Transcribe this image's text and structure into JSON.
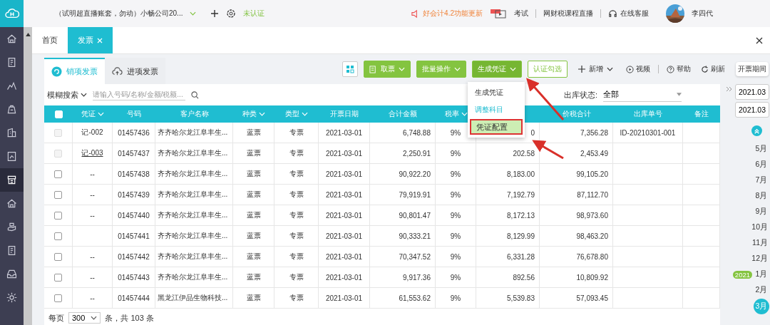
{
  "sidebar": {
    "items": [
      {
        "kind": "home",
        "selected": false
      },
      {
        "kind": "document",
        "selected": false
      },
      {
        "kind": "chart",
        "selected": false
      },
      {
        "kind": "bag",
        "selected": false
      },
      {
        "kind": "building",
        "selected": false
      },
      {
        "kind": "report",
        "selected": false
      },
      {
        "kind": "invoice",
        "selected": true
      },
      {
        "kind": "home",
        "selected": false
      },
      {
        "kind": "hand",
        "selected": false
      },
      {
        "kind": "document",
        "selected": false
      },
      {
        "kind": "tray",
        "selected": false
      },
      {
        "kind": "gear",
        "selected": false
      }
    ]
  },
  "header": {
    "account": "（试明超直播账套，勿动）小畅公司20...",
    "status": "未认证",
    "notice": "好会计4.2功能更新",
    "exam": "考试",
    "live": "网财税课程直播",
    "service": "在线客服",
    "user": "李四代"
  },
  "tabs": [
    {
      "label": "首页",
      "selected": false
    },
    {
      "label": "发票",
      "selected": true
    }
  ],
  "subtabs": [
    {
      "label": "销项发票",
      "selected": true
    },
    {
      "label": "进项发票",
      "selected": false
    }
  ],
  "toolbar": {
    "buttons": [
      {
        "label": "取票",
        "kind": "solid",
        "expanded": false
      },
      {
        "label": "批量操作",
        "kind": "solid",
        "expanded": false
      },
      {
        "label": "生成凭证",
        "kind": "solid",
        "expanded": true
      },
      {
        "label": "认证勾选",
        "kind": "outline",
        "expanded": false
      },
      {
        "label": "新增",
        "kind": "add",
        "expanded": false
      }
    ],
    "links": [
      {
        "label": "视频",
        "kind": "video"
      },
      {
        "label": "帮助",
        "kind": "help"
      },
      {
        "label": "刷新",
        "kind": "refresh"
      }
    ],
    "period_tooltip": "开票期间"
  },
  "menu": [
    {
      "label": "生成凭证",
      "kind": "plain",
      "selected": false
    },
    {
      "label": "调整科目",
      "kind": "accent",
      "selected": false
    },
    {
      "label": "凭证配置",
      "kind": "plain",
      "selected": true
    }
  ],
  "search": {
    "mode": "模糊搜索",
    "placeholder": "请输入号码/名称/金额/税额...",
    "filter_label": "出库状态:",
    "filter_value": "全部"
  },
  "table": {
    "select_all": {
      "checked": false
    },
    "columns": [
      {
        "label": "凭证",
        "sortable": true
      },
      {
        "label": "号码",
        "sortable": false
      },
      {
        "label": "客户名称",
        "sortable": false
      },
      {
        "label": "种类",
        "sortable": true
      },
      {
        "label": "类型",
        "sortable": true
      },
      {
        "label": "开票日期",
        "sortable": false
      },
      {
        "label": "合计金额",
        "sortable": false
      },
      {
        "label": "税率",
        "sortable": true
      },
      {},
      {
        "label": "价税合计",
        "sortable": false
      },
      {
        "label": "出库单号",
        "sortable": false
      },
      {
        "label": "备注",
        "sortable": false
      }
    ],
    "rows": [
      {
        "checked": false,
        "disabled": true,
        "voucher": "记-002",
        "voucher_link": false,
        "number": "01457436",
        "customer": "齐齐哈尔龙江阜丰生...",
        "kind": "蓝票",
        "type": "专票",
        "date": "2021-03-01",
        "amount": "6,748.88",
        "rate": "9%",
        "tax": "0",
        "total": "7,356.28",
        "outbound": "ID-20210301-001"
      },
      {
        "checked": false,
        "disabled": true,
        "voucher": "记-003",
        "voucher_link": true,
        "number": "01457437",
        "customer": "齐齐哈尔龙江阜丰生...",
        "kind": "蓝票",
        "type": "专票",
        "date": "2021-03-01",
        "amount": "2,250.91",
        "rate": "9%",
        "tax": "202.58",
        "total": "2,453.49"
      },
      {
        "checked": false,
        "disabled": false,
        "voucher": "--",
        "voucher_link": false,
        "number": "01457438",
        "customer": "齐齐哈尔龙江阜丰生...",
        "kind": "蓝票",
        "type": "专票",
        "date": "2021-03-01",
        "amount": "90,922.20",
        "rate": "9%",
        "tax": "8,183.00",
        "total": "99,105.20"
      },
      {
        "checked": false,
        "disabled": false,
        "voucher": "--",
        "voucher_link": false,
        "number": "01457439",
        "customer": "齐齐哈尔龙江阜丰生...",
        "kind": "蓝票",
        "type": "专票",
        "date": "2021-03-01",
        "amount": "79,919.91",
        "rate": "9%",
        "tax": "7,192.79",
        "total": "87,112.70"
      },
      {
        "checked": false,
        "disabled": false,
        "voucher": "--",
        "voucher_link": false,
        "number": "01457440",
        "customer": "齐齐哈尔龙江阜丰生...",
        "kind": "蓝票",
        "type": "专票",
        "date": "2021-03-01",
        "amount": "90,801.47",
        "rate": "9%",
        "tax": "8,172.13",
        "total": "98,973.60"
      },
      {
        "checked": false,
        "disabled": false,
        "voucher_link": false,
        "number": "01457441",
        "customer": "齐齐哈尔龙江阜丰生...",
        "kind": "蓝票",
        "type": "专票",
        "date": "2021-03-01",
        "amount": "90,333.21",
        "rate": "9%",
        "tax": "8,129.99",
        "total": "98,463.20"
      },
      {
        "checked": false,
        "disabled": false,
        "voucher": "--",
        "voucher_link": false,
        "number": "01457442",
        "customer": "齐齐哈尔龙江阜丰生...",
        "kind": "蓝票",
        "type": "专票",
        "date": "2021-03-01",
        "amount": "70,347.52",
        "rate": "9%",
        "tax": "6,331.28",
        "total": "76,678.80"
      },
      {
        "checked": false,
        "disabled": false,
        "voucher": "--",
        "voucher_link": false,
        "number": "01457443",
        "customer": "齐齐哈尔龙江阜丰生...",
        "kind": "蓝票",
        "type": "专票",
        "date": "2021-03-01",
        "amount": "9,917.36",
        "rate": "9%",
        "tax": "892.56",
        "total": "10,809.92"
      },
      {
        "checked": false,
        "disabled": false,
        "voucher": "--",
        "voucher_link": false,
        "number": "01457444",
        "customer": "黑龙江伊品生物科技...",
        "kind": "蓝票",
        "type": "专票",
        "date": "2021-03-01",
        "amount": "61,553.62",
        "rate": "9%",
        "tax": "5,539.83",
        "total": "57,093.45"
      }
    ]
  },
  "pagination": {
    "prefix": "每页",
    "page_size": "300",
    "summary": "条，共 103 条"
  },
  "period": {
    "start": "2021.03",
    "end": "2021.03",
    "months": [
      {
        "label": "5月",
        "selected": false
      },
      {
        "label": "6月",
        "selected": false
      },
      {
        "label": "7月",
        "selected": false
      },
      {
        "label": "8月",
        "selected": false
      },
      {
        "label": "9月",
        "selected": false
      },
      {
        "label": "10月",
        "selected": false
      },
      {
        "label": "11月",
        "selected": false
      },
      {
        "label": "12月",
        "selected": false
      },
      {
        "label": "1月",
        "selected": false,
        "year": "2021"
      },
      {
        "label": "2月",
        "selected": false
      },
      {
        "label": "3月",
        "selected": true
      }
    ]
  }
}
